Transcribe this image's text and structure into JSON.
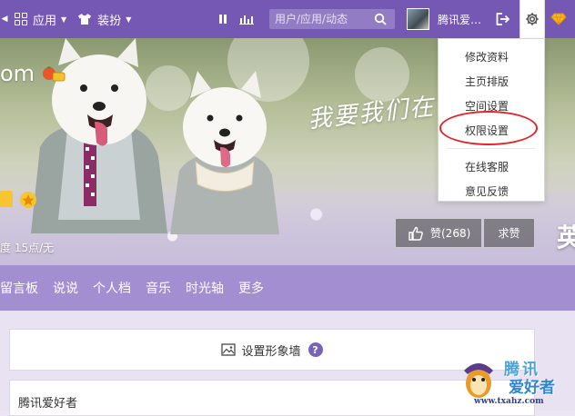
{
  "topbar": {
    "apps_label": "应用",
    "dressup_label": "装扮",
    "search_placeholder": "用户/应用/动态",
    "username": "腾讯爱…"
  },
  "banner": {
    "brand_text": "om",
    "space_text": "度 15点/无",
    "slogan": "我要我们在",
    "like_label": "赞(268)",
    "ask_label": "求赞",
    "deco_char": "英"
  },
  "nav": {
    "items": [
      "留言板",
      "说说",
      "个人档",
      "音乐",
      "时光轴",
      "更多"
    ]
  },
  "content": {
    "wall_label": "设置形象墙",
    "help_mark": "?",
    "owner_name": "腾讯爱好者"
  },
  "dropdown": {
    "items": [
      "修改资料",
      "主页排版",
      "空间设置",
      "权限设置",
      "在线客服",
      "意见反馈"
    ]
  },
  "watermark": {
    "brand": "腾讯",
    "site": "爱好者",
    "url": "www.txahz.com"
  },
  "colors": {
    "topbar": "#7458b3",
    "nav": "#a48ed2",
    "highlight_ring": "#e0262a"
  }
}
